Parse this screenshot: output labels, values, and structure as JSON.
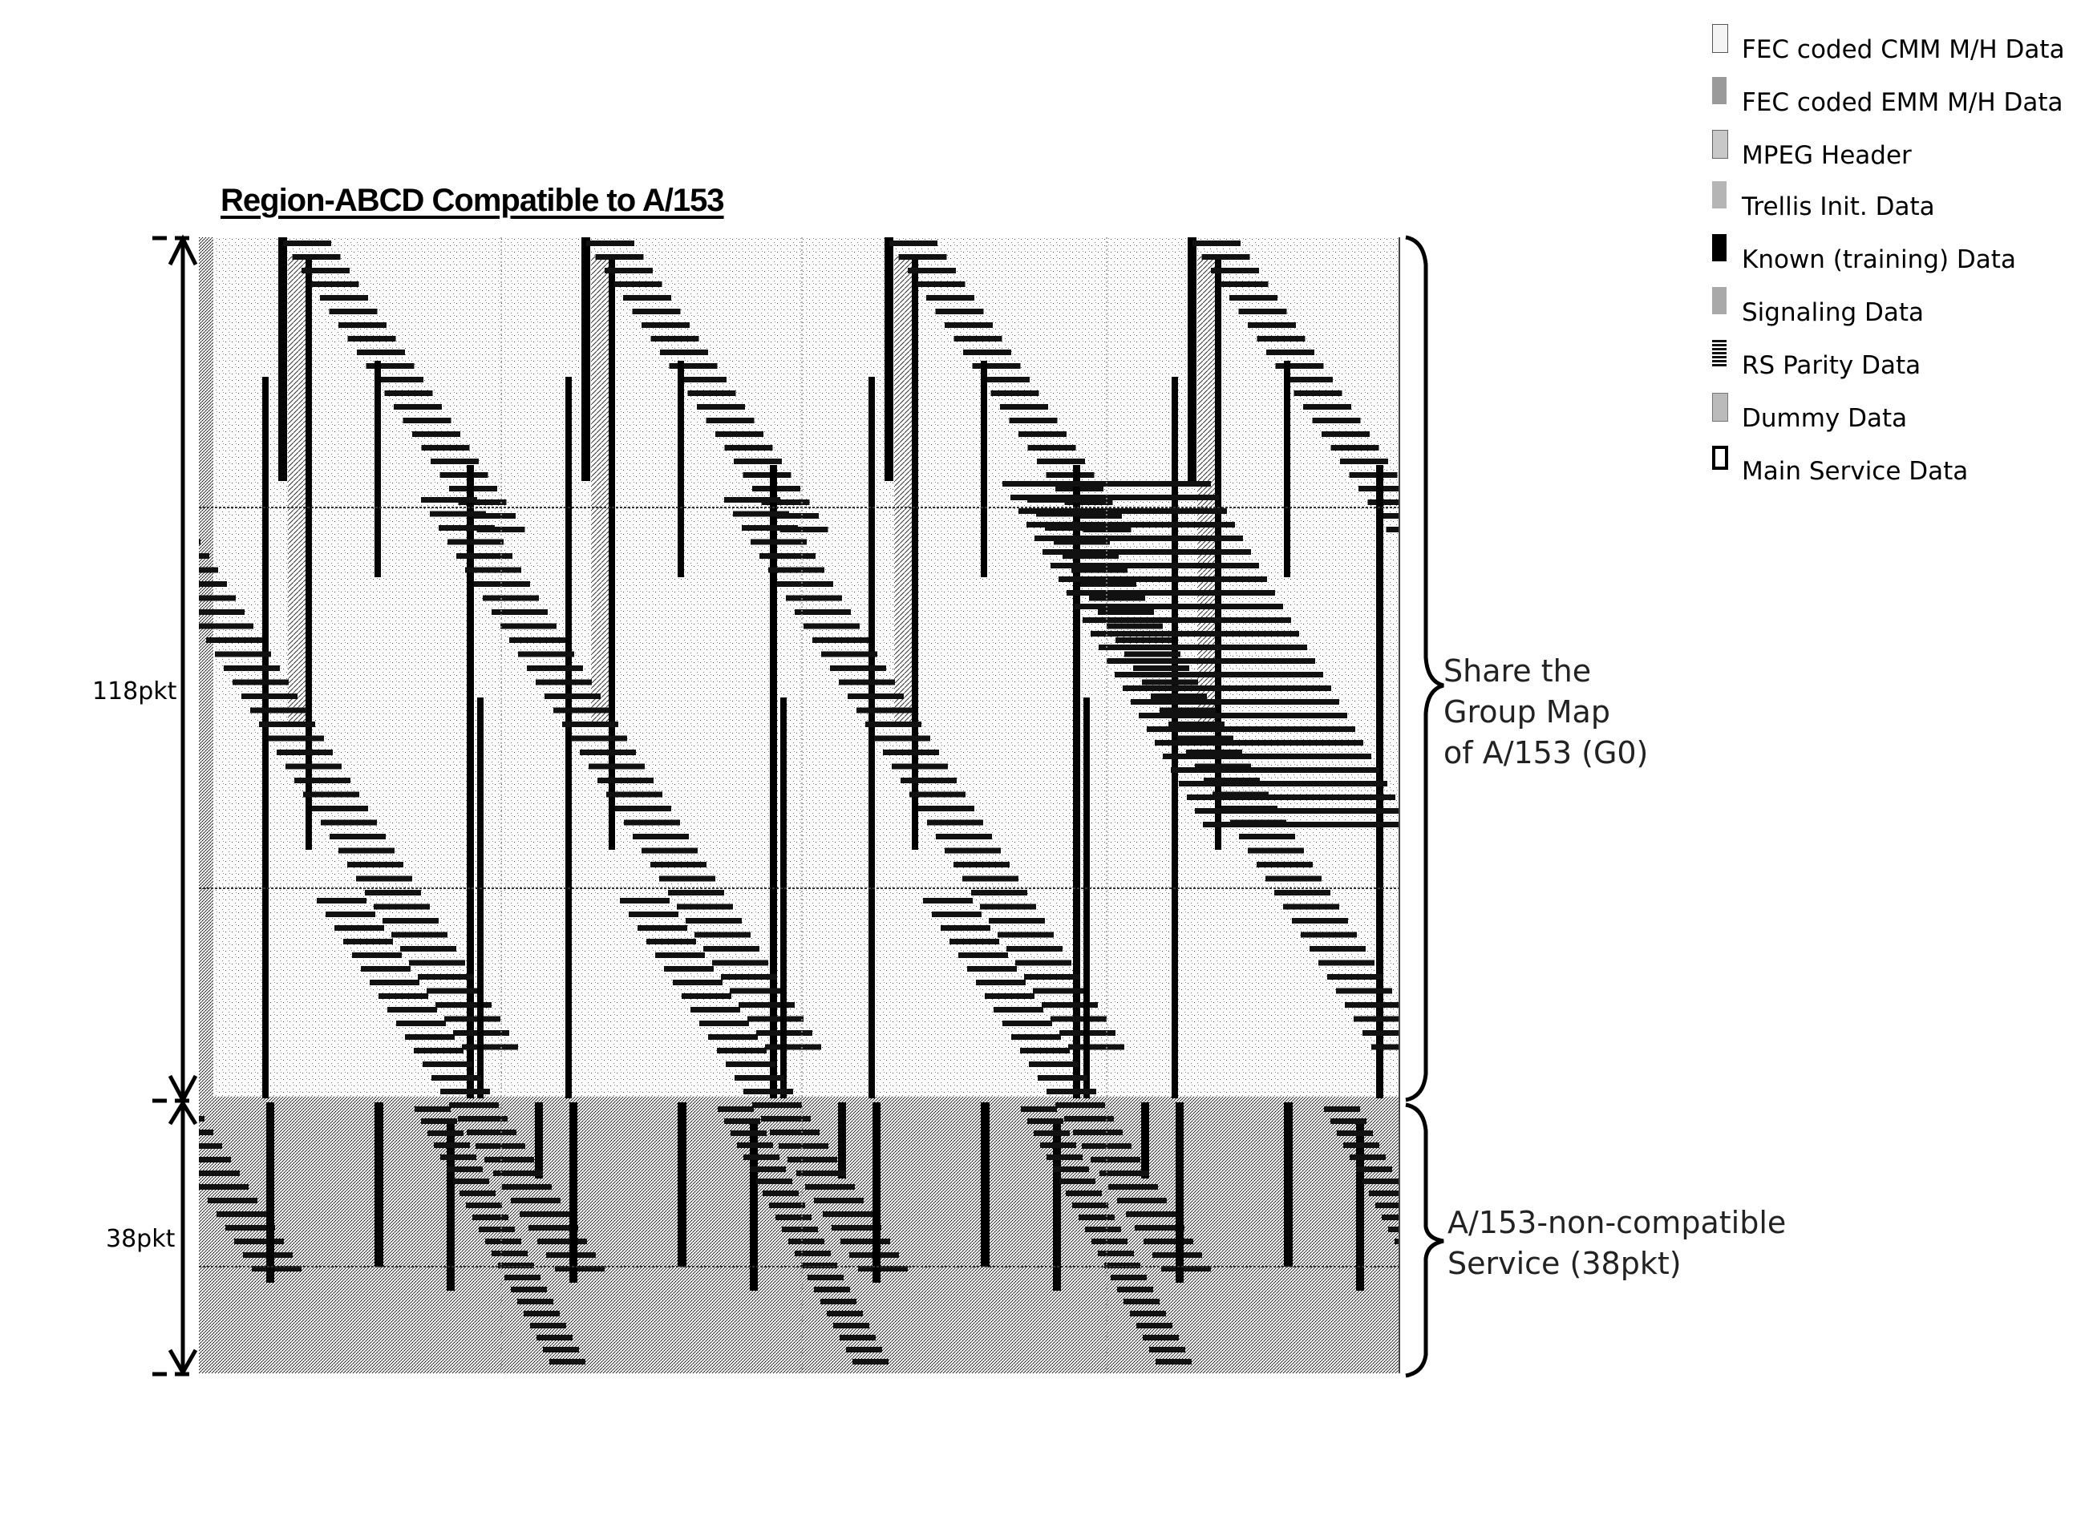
{
  "title": "Region-ABCD Compatible to A/153",
  "dimensions": {
    "upper": {
      "label": "118pkt",
      "packets": 118
    },
    "lower": {
      "label": "38pkt",
      "packets": 38
    }
  },
  "side_labels": {
    "upper": "Share the\nGroup Map\nof A/153 (G0)",
    "lower": "A/153-non-compatible\nService (38pkt)"
  },
  "legend": [
    {
      "id": "fec-cmm",
      "label": "FEC coded CMM M/H Data",
      "pattern": "light-dots"
    },
    {
      "id": "fec-emm",
      "label": "FEC coded EMM M/H Data",
      "pattern": "dense-dots"
    },
    {
      "id": "mpeg-header",
      "label": "MPEG Header",
      "pattern": "medium-dots"
    },
    {
      "id": "trellis-init",
      "label": "Trellis Init. Data",
      "pattern": "diagonal-dots"
    },
    {
      "id": "known-data",
      "label": "Known (training) Data",
      "pattern": "solid-black"
    },
    {
      "id": "signaling",
      "label": "Signaling Data",
      "pattern": "checker-dots"
    },
    {
      "id": "rs-parity",
      "label": "RS Parity Data",
      "pattern": "horizontal-stripes"
    },
    {
      "id": "dummy",
      "label": "Dummy Data",
      "pattern": "grid-dots"
    },
    {
      "id": "main-service",
      "label": "Main Service Data",
      "pattern": "empty-box"
    }
  ],
  "diagram": {
    "groups_repeated": 4,
    "upper_region": {
      "fill": "fec-cmm",
      "packets": 118
    },
    "lower_region": {
      "fill": "fec-emm",
      "packets": 38
    }
  },
  "colors": {
    "ink": "#000000",
    "background": "#ffffff",
    "upper_fill": "#f2f2f2",
    "lower_fill": "#bdbdbd"
  }
}
